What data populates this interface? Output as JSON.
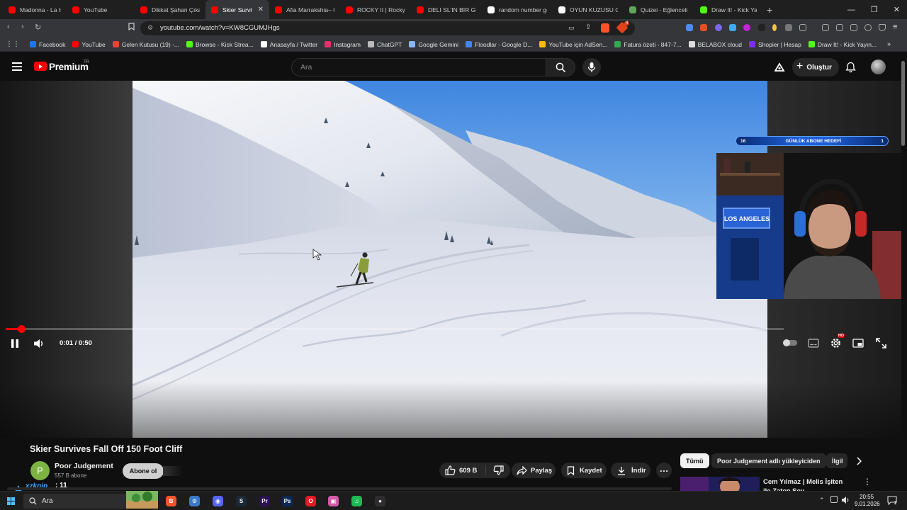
{
  "browser": {
    "tabs": [
      {
        "label": "Madonna - La Isla B",
        "favicon_color": "#ff0000",
        "active": false
      },
      {
        "label": "YouTube",
        "favicon_color": "#ff0000",
        "active": false
      },
      {
        "label": "Dikkat Şahan Çıkab",
        "favicon_color": "#ff0000",
        "active": false
      },
      {
        "label": "Skier Survive",
        "favicon_color": "#ff0000",
        "active": true
      },
      {
        "label": "Afia Marrakshia– Or",
        "favicon_color": "#ff0000",
        "active": false
      },
      {
        "label": "ROCKY II | Rocky's F",
        "favicon_color": "#ff0000",
        "active": false
      },
      {
        "label": "DELI SL'IN BIR GÜN",
        "favicon_color": "#ff0000",
        "active": false
      },
      {
        "label": "random number ge",
        "favicon_color": "#ffffff",
        "active": false
      },
      {
        "label": "OYUN KUZUSU OY",
        "favicon_color": "#ffffff",
        "active": false
      },
      {
        "label": "Quizei - Eğlenceli v",
        "favicon_color": "#5fa55a",
        "active": false
      },
      {
        "label": "Draw It! - Kick Yayın",
        "favicon_color": "#53fc18",
        "active": false
      }
    ],
    "new_tab": "+",
    "window_controls": [
      "—",
      "❐",
      "✕"
    ],
    "url": "youtube.com/watch?v=KW8CGUMJHgs",
    "extension_badge": "4",
    "bookmarks": [
      {
        "label": "Facebook",
        "color": "#1877f2"
      },
      {
        "label": "YouTube",
        "color": "#ff0000"
      },
      {
        "label": "Gelen Kutusu (19) -...",
        "color": "#ea4335"
      },
      {
        "label": "Browse - Kick Strea...",
        "color": "#53fc18"
      },
      {
        "label": "Anasayfa / Twitter",
        "color": "#ffffff"
      },
      {
        "label": "Instagram",
        "color": "#e1306c"
      },
      {
        "label": "ChatGPT",
        "color": "#bbbbbb"
      },
      {
        "label": "Google Gemini",
        "color": "#8ab4f8"
      },
      {
        "label": "Floodlar - Google D...",
        "color": "#4285f4"
      },
      {
        "label": "YouTube için AdSen...",
        "color": "#fbbc04"
      },
      {
        "label": "Fatura özeti - 847-7...",
        "color": "#34a853"
      },
      {
        "label": "BELABOX cloud",
        "color": "#dddddd"
      },
      {
        "label": "Shopier | Hesap",
        "color": "#7b2ff7"
      },
      {
        "label": "Draw It! - Kick Yayın...",
        "color": "#53fc18"
      }
    ]
  },
  "youtube": {
    "logo_text": "Premium",
    "logo_country": "TR",
    "search_placeholder": "Ara",
    "create_label": "Oluştur"
  },
  "player": {
    "time_current": "0:01",
    "time_total": "0:50",
    "time_display": "0:01 / 0:50",
    "progress_fraction": 0.02,
    "settings_badge": "HD"
  },
  "overlay": {
    "goal_left": "16",
    "goal_label": "GÜNLÜK ABONE HEDEFİ",
    "goal_right": "1"
  },
  "video": {
    "title": "Skier Survives Fall Off 150 Foot Cliff",
    "channel_initial": "P",
    "channel_name": "Poor Judgement",
    "subscribers": "557 B abone",
    "subscribe_label": "Abone ol",
    "like_count": "609 B",
    "share_label": "Paylaş",
    "save_label": "Kaydet",
    "download_label": "İndir"
  },
  "chat": {
    "username": "xzknip",
    "message": ": 11"
  },
  "sidebar": {
    "chips": [
      "Tümü",
      "Poor Judgement adlı yükleyiciden",
      "İlgil"
    ],
    "recommendation_title": "Cem Yılmaz | Melis İşiten ile Zaten Sev"
  },
  "taskbar": {
    "search_label": "Ara",
    "time": "20:55",
    "date": "9.01.2026",
    "notification_count": "2",
    "apps": [
      {
        "name": "brave",
        "color": "#fb542b",
        "glyph": "B"
      },
      {
        "name": "network-tool",
        "color": "#3a78c8",
        "glyph": "⚙"
      },
      {
        "name": "discord",
        "color": "#5865f2",
        "glyph": "◉"
      },
      {
        "name": "steam",
        "color": "#1b2838",
        "glyph": "S"
      },
      {
        "name": "premiere-pro",
        "color": "#2a1155",
        "glyph": "Pr"
      },
      {
        "name": "photoshop",
        "color": "#0a2a55",
        "glyph": "Ps"
      },
      {
        "name": "opera",
        "color": "#e31b23",
        "glyph": "O"
      },
      {
        "name": "photos",
        "color": "#d45aa8",
        "glyph": "▣"
      },
      {
        "name": "spotify",
        "color": "#1db954",
        "glyph": "♫"
      },
      {
        "name": "obs",
        "color": "#302e31",
        "glyph": "●"
      }
    ]
  }
}
